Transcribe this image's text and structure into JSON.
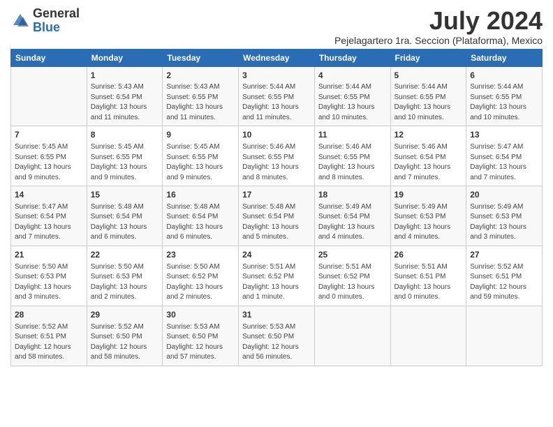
{
  "logo": {
    "general": "General",
    "blue": "Blue"
  },
  "title": "July 2024",
  "subtitle": "Pejelagartero 1ra. Seccion (Plataforma), Mexico",
  "days_of_week": [
    "Sunday",
    "Monday",
    "Tuesday",
    "Wednesday",
    "Thursday",
    "Friday",
    "Saturday"
  ],
  "weeks": [
    [
      {
        "day": "",
        "info": ""
      },
      {
        "day": "1",
        "info": "Sunrise: 5:43 AM\nSunset: 6:54 PM\nDaylight: 13 hours\nand 11 minutes."
      },
      {
        "day": "2",
        "info": "Sunrise: 5:43 AM\nSunset: 6:55 PM\nDaylight: 13 hours\nand 11 minutes."
      },
      {
        "day": "3",
        "info": "Sunrise: 5:44 AM\nSunset: 6:55 PM\nDaylight: 13 hours\nand 11 minutes."
      },
      {
        "day": "4",
        "info": "Sunrise: 5:44 AM\nSunset: 6:55 PM\nDaylight: 13 hours\nand 10 minutes."
      },
      {
        "day": "5",
        "info": "Sunrise: 5:44 AM\nSunset: 6:55 PM\nDaylight: 13 hours\nand 10 minutes."
      },
      {
        "day": "6",
        "info": "Sunrise: 5:44 AM\nSunset: 6:55 PM\nDaylight: 13 hours\nand 10 minutes."
      }
    ],
    [
      {
        "day": "7",
        "info": "Sunrise: 5:45 AM\nSunset: 6:55 PM\nDaylight: 13 hours\nand 9 minutes."
      },
      {
        "day": "8",
        "info": "Sunrise: 5:45 AM\nSunset: 6:55 PM\nDaylight: 13 hours\nand 9 minutes."
      },
      {
        "day": "9",
        "info": "Sunrise: 5:45 AM\nSunset: 6:55 PM\nDaylight: 13 hours\nand 9 minutes."
      },
      {
        "day": "10",
        "info": "Sunrise: 5:46 AM\nSunset: 6:55 PM\nDaylight: 13 hours\nand 8 minutes."
      },
      {
        "day": "11",
        "info": "Sunrise: 5:46 AM\nSunset: 6:55 PM\nDaylight: 13 hours\nand 8 minutes."
      },
      {
        "day": "12",
        "info": "Sunrise: 5:46 AM\nSunset: 6:54 PM\nDaylight: 13 hours\nand 7 minutes."
      },
      {
        "day": "13",
        "info": "Sunrise: 5:47 AM\nSunset: 6:54 PM\nDaylight: 13 hours\nand 7 minutes."
      }
    ],
    [
      {
        "day": "14",
        "info": "Sunrise: 5:47 AM\nSunset: 6:54 PM\nDaylight: 13 hours\nand 7 minutes."
      },
      {
        "day": "15",
        "info": "Sunrise: 5:48 AM\nSunset: 6:54 PM\nDaylight: 13 hours\nand 6 minutes."
      },
      {
        "day": "16",
        "info": "Sunrise: 5:48 AM\nSunset: 6:54 PM\nDaylight: 13 hours\nand 6 minutes."
      },
      {
        "day": "17",
        "info": "Sunrise: 5:48 AM\nSunset: 6:54 PM\nDaylight: 13 hours\nand 5 minutes."
      },
      {
        "day": "18",
        "info": "Sunrise: 5:49 AM\nSunset: 6:54 PM\nDaylight: 13 hours\nand 4 minutes."
      },
      {
        "day": "19",
        "info": "Sunrise: 5:49 AM\nSunset: 6:53 PM\nDaylight: 13 hours\nand 4 minutes."
      },
      {
        "day": "20",
        "info": "Sunrise: 5:49 AM\nSunset: 6:53 PM\nDaylight: 13 hours\nand 3 minutes."
      }
    ],
    [
      {
        "day": "21",
        "info": "Sunrise: 5:50 AM\nSunset: 6:53 PM\nDaylight: 13 hours\nand 3 minutes."
      },
      {
        "day": "22",
        "info": "Sunrise: 5:50 AM\nSunset: 6:53 PM\nDaylight: 13 hours\nand 2 minutes."
      },
      {
        "day": "23",
        "info": "Sunrise: 5:50 AM\nSunset: 6:52 PM\nDaylight: 13 hours\nand 2 minutes."
      },
      {
        "day": "24",
        "info": "Sunrise: 5:51 AM\nSunset: 6:52 PM\nDaylight: 13 hours\nand 1 minute."
      },
      {
        "day": "25",
        "info": "Sunrise: 5:51 AM\nSunset: 6:52 PM\nDaylight: 13 hours\nand 0 minutes."
      },
      {
        "day": "26",
        "info": "Sunrise: 5:51 AM\nSunset: 6:51 PM\nDaylight: 13 hours\nand 0 minutes."
      },
      {
        "day": "27",
        "info": "Sunrise: 5:52 AM\nSunset: 6:51 PM\nDaylight: 12 hours\nand 59 minutes."
      }
    ],
    [
      {
        "day": "28",
        "info": "Sunrise: 5:52 AM\nSunset: 6:51 PM\nDaylight: 12 hours\nand 58 minutes."
      },
      {
        "day": "29",
        "info": "Sunrise: 5:52 AM\nSunset: 6:50 PM\nDaylight: 12 hours\nand 58 minutes."
      },
      {
        "day": "30",
        "info": "Sunrise: 5:53 AM\nSunset: 6:50 PM\nDaylight: 12 hours\nand 57 minutes."
      },
      {
        "day": "31",
        "info": "Sunrise: 5:53 AM\nSunset: 6:50 PM\nDaylight: 12 hours\nand 56 minutes."
      },
      {
        "day": "",
        "info": ""
      },
      {
        "day": "",
        "info": ""
      },
      {
        "day": "",
        "info": ""
      }
    ]
  ]
}
